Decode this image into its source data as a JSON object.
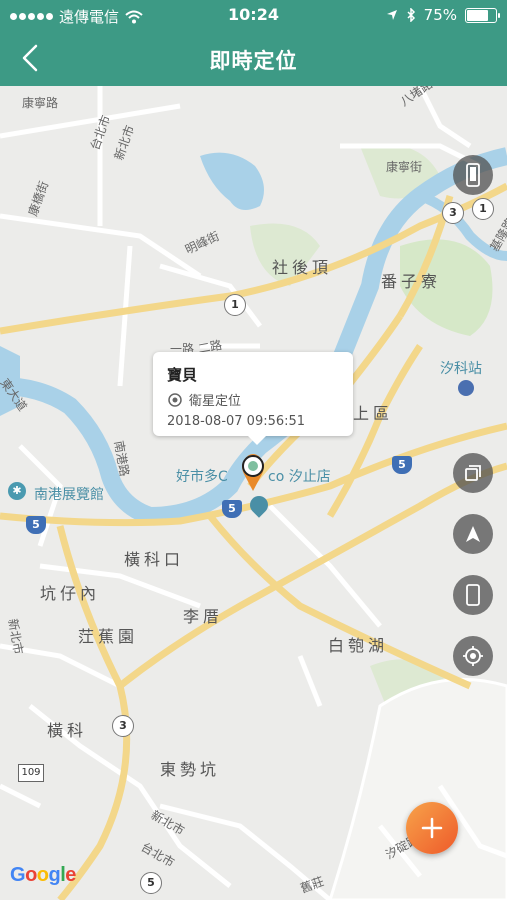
{
  "status_bar": {
    "carrier": "遠傳電信",
    "time": "10:24",
    "battery": "75%",
    "battery_level": 0.75
  },
  "nav": {
    "title": "即時定位"
  },
  "callout": {
    "name": "寶貝",
    "location_type": "衛星定位",
    "timestamp": "2018-08-07 09:56:51"
  },
  "map": {
    "area_labels": {
      "shehouding": "社後頂",
      "fanzihliao": "番子寮",
      "hengkekou": "橫科口",
      "kengzainei": "坑仔內",
      "jianjiaoyuan": "茳蕉園",
      "lili": "李厝",
      "baibaohu": "白匏湖",
      "hengke": "橫科",
      "dongshikeng": "東勢坑",
      "shangqu": "上區"
    },
    "street_labels": {
      "kangning_road": "康寧路",
      "taibei_city": "台北市",
      "xinbei_city": "新北市",
      "kangqiao_street": "康橋街",
      "mingfeng_street": "明峰街",
      "kangning_street": "康寧街",
      "badu_road": "八堵路",
      "jilong_road": "基隆路",
      "datong_road": "東大道",
      "xinbei_city2": "新北市",
      "taibei_city2": "台北市",
      "xinbei_city3": "新北市",
      "xidu_road": "汐碇路",
      "jiuzhuang": "舊莊",
      "nangang_street": "南港路",
      "road_yi": "一路",
      "road_er": "二路",
      "taian_street": "康寧街"
    },
    "poi_labels": {
      "xike_station": "汐科站",
      "nangang_exhibition": "南港展覽館",
      "costco_a": "好市多C",
      "costco_b": "co 汐止店"
    },
    "route_shields": {
      "r1": "1",
      "r1b": "1",
      "r3": "3",
      "r3b": "3",
      "r5a": "5",
      "r5b": "5",
      "r5c": "5",
      "r5d": "5",
      "r109": "109"
    },
    "attribution": "Google"
  },
  "controls": {
    "icons": [
      "phone-toggle-icon",
      "layers-icon",
      "navigation-arrow-icon",
      "device-icon",
      "my-location-icon",
      "add-icon"
    ]
  },
  "colors": {
    "header": "#3d9a85",
    "water": "#a9d1e8",
    "road_major": "#f3d78a",
    "road_minor": "#ffffff",
    "fab_gradient_start": "#f7a34a",
    "fab_gradient_end": "#ee5a2a",
    "marker": "#e98a2a"
  }
}
